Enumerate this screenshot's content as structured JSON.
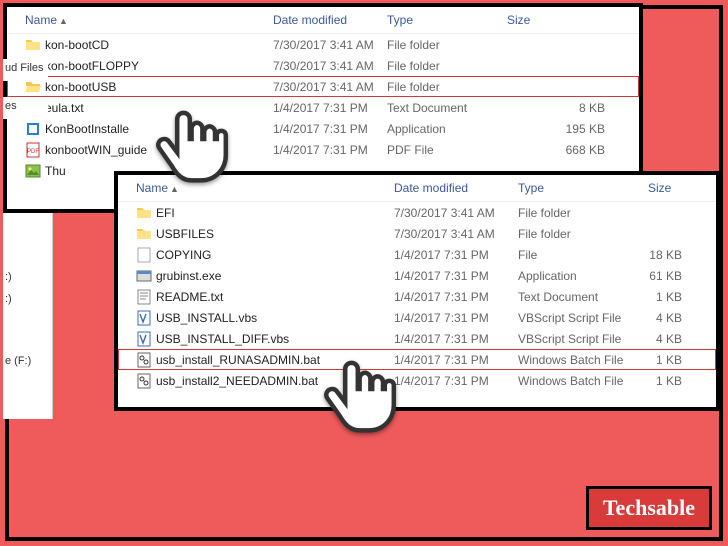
{
  "columns": {
    "name": "Name",
    "date": "Date modified",
    "type": "Type",
    "size": "Size"
  },
  "pane1": {
    "rows": [
      {
        "icon": "folder",
        "name": "kon-bootCD",
        "date": "7/30/2017 3:41 AM",
        "type": "File folder",
        "size": ""
      },
      {
        "icon": "folder",
        "name": "kon-bootFLOPPY",
        "date": "7/30/2017 3:41 AM",
        "type": "File folder",
        "size": ""
      },
      {
        "icon": "folder-open",
        "name": "kon-bootUSB",
        "date": "7/30/2017 3:41 AM",
        "type": "File folder",
        "size": "",
        "highlight": true
      },
      {
        "icon": "txt",
        "name": "eula.txt",
        "date": "1/4/2017 7:31 PM",
        "type": "Text Document",
        "size": "8 KB"
      },
      {
        "icon": "app",
        "name": "KonBootInstalle",
        "date": "1/4/2017 7:31 PM",
        "type": "Application",
        "size": "195 KB"
      },
      {
        "icon": "pdf",
        "name": "konbootWIN_guide",
        "date": "1/4/2017 7:31 PM",
        "type": "PDF File",
        "size": "668 KB"
      },
      {
        "icon": "img",
        "name": "Thu",
        "date": "",
        "type": "",
        "size": ""
      }
    ]
  },
  "pane2": {
    "rows": [
      {
        "icon": "folder",
        "name": "EFI",
        "date": "7/30/2017 3:41 AM",
        "type": "File folder",
        "size": ""
      },
      {
        "icon": "folder",
        "name": "USBFILES",
        "date": "7/30/2017 3:41 AM",
        "type": "File folder",
        "size": ""
      },
      {
        "icon": "file",
        "name": "COPYING",
        "date": "1/4/2017 7:31 PM",
        "type": "File",
        "size": "18 KB"
      },
      {
        "icon": "exe",
        "name": "grubinst.exe",
        "date": "1/4/2017 7:31 PM",
        "type": "Application",
        "size": "61 KB"
      },
      {
        "icon": "txt",
        "name": "README.txt",
        "date": "1/4/2017 7:31 PM",
        "type": "Text Document",
        "size": "1 KB"
      },
      {
        "icon": "vbs",
        "name": "USB_INSTALL.vbs",
        "date": "1/4/2017 7:31 PM",
        "type": "VBScript Script File",
        "size": "4 KB"
      },
      {
        "icon": "vbs",
        "name": "USB_INSTALL_DIFF.vbs",
        "date": "1/4/2017 7:31 PM",
        "type": "VBScript Script File",
        "size": "4 KB"
      },
      {
        "icon": "bat",
        "name": "usb_install_RUNASADMIN.bat",
        "date": "1/4/2017 7:31 PM",
        "type": "Windows Batch File",
        "size": "1 KB",
        "highlight": true
      },
      {
        "icon": "bat",
        "name": "usb_install2_NEEDADMIN.bat",
        "date": "1/4/2017 7:31 PM",
        "type": "Windows Batch File",
        "size": "1 KB"
      }
    ]
  },
  "sidebar": {
    "items": [
      "ud Files",
      "es",
      ":)",
      ":)",
      "e (F:)"
    ]
  },
  "branding": {
    "label": "Techsable"
  }
}
